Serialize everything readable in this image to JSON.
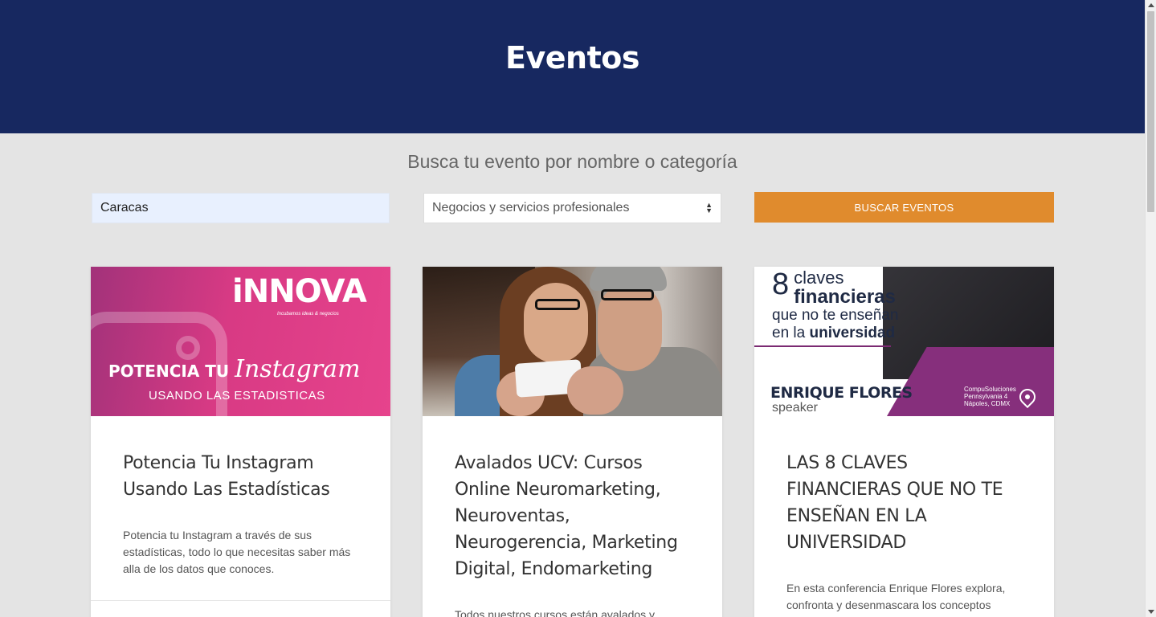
{
  "header": {
    "title": "Eventos"
  },
  "search": {
    "title": "Busca tu evento por nombre o categoría",
    "city_value": "Caracas",
    "category_selected": "Negocios y servicios profesionales",
    "button_label": "BUSCAR EVENTOS"
  },
  "events": [
    {
      "title": "Potencia Tu Instagram Usando Las Estadísticas",
      "description": "Potencia tu Instagram a través de sus estadísticas, todo lo que necesitas saber más alla de los datos que conoces.",
      "image": {
        "logo": "iNNOVA",
        "logo_tagline": "Incubamos ideas & negocios",
        "headline_bold": "POTENCIA TU",
        "headline_script": "Instagram",
        "subline": "USANDO LAS ESTADISTICAS"
      }
    },
    {
      "title": "Avalados UCV: Cursos Online Neuromarketing, Neuroventas, Neurogerencia, Marketing Digital, Endomarketing",
      "description": "Todos nuestros cursos están avalados y"
    },
    {
      "title": "LAS 8 CLAVES FINANCIERAS QUE NO TE ENSEÑAN EN LA UNIVERSIDAD",
      "description": "En esta conferencia Enrique Flores explora, confronta y desenmascara los conceptos absurdos que nos enseñaron y nos siguen",
      "image": {
        "number": "8",
        "line1": "claves",
        "line2": "financieras",
        "line3": "que no te enseñan",
        "line4_prefix": "en la",
        "line4_bold": "universidad",
        "speaker_name": "ENRIQUE FLORES",
        "speaker_role": "speaker",
        "venue_name": "CompuSoluciones",
        "venue_line1": "Pennsylvania 4",
        "venue_line2": "Nápoles, CDMX"
      }
    }
  ],
  "colors": {
    "hero_bg": "#172860",
    "page_bg": "#e4e4e4",
    "button_bg": "#e08b2d",
    "input_autofill_bg": "#e8f0fe"
  }
}
